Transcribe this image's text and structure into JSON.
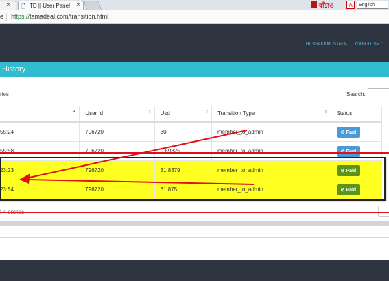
{
  "browser": {
    "tab_prev_close": "×",
    "tab_title": "TD || User Panel",
    "address_prefix": "e",
    "url_scheme": "https://",
    "url_rest": "tamadeal.com/transition.html",
    "ext_text": "বাঁচাও",
    "language": "English"
  },
  "nav": {
    "greeting": "HI, SHAKILMUSTAFA,",
    "user_id_label": "YOUR ID IS= 7"
  },
  "panel": {
    "title": "History",
    "entries_prefix": "ries",
    "search_label": "Search:",
    "footer_entries": "f 4 entries"
  },
  "table": {
    "headers": [
      "",
      "User Id",
      "Usd",
      "Transition Type",
      "Status"
    ],
    "rows": [
      {
        "time": "55:24",
        "user_id": "796720",
        "usd": "30",
        "type": "member_to_admin",
        "status": "Paid"
      },
      {
        "time": "55:58",
        "user_id": "796720",
        "usd": "0.69325",
        "type": "member_to_admin",
        "status": "Paid"
      },
      {
        "time": "23:23",
        "user_id": "796720",
        "usd": "31.8379",
        "type": "member_to_admin",
        "status": "Paid"
      },
      {
        "time": "23:54",
        "user_id": "796720",
        "usd": "61.875",
        "type": "member_to_admin",
        "status": "Paid"
      }
    ]
  },
  "colors": {
    "nav_bg": "#2e3440",
    "panel_header": "#32bcd0",
    "highlight": "#ffff22",
    "annotation_red": "#e01018",
    "paid_blue": "#4a9ad8",
    "paid_green": "#5a9418"
  }
}
